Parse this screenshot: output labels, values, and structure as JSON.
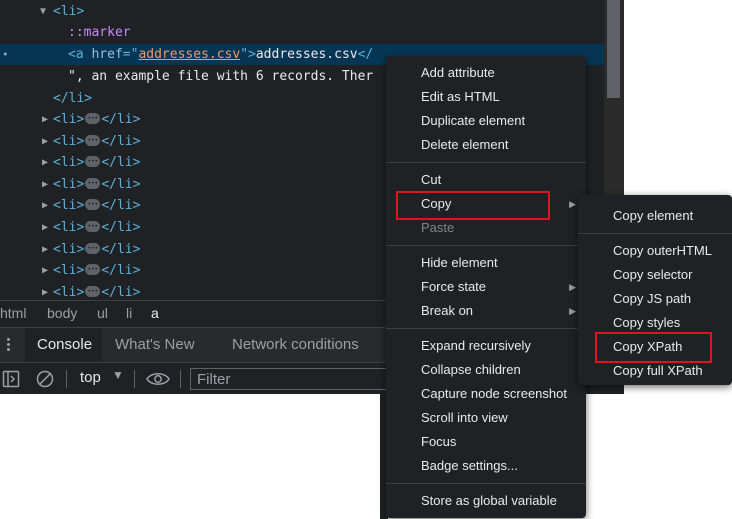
{
  "elements_tree": {
    "lines": [
      {
        "open": "<li>"
      },
      {
        "pseudo": "::marker"
      },
      {
        "a_open": "<a ",
        "href_attr": "href",
        "href_eq": "=\"",
        "href_val": "addresses.csv",
        "href_close": "\">",
        "text": "addresses.csv",
        "tail": "</"
      },
      {
        "text": "\", an example file with 6 records. Ther"
      },
      {
        "close": "</li>"
      },
      {
        "collapsed": "<li>",
        "end": "</li>"
      }
    ],
    "collapsed_count": 9
  },
  "breadcrumb": [
    "html",
    "body",
    "ul",
    "li",
    "a"
  ],
  "drawer": {
    "tabs": [
      "Console",
      "What's New",
      "Network conditions"
    ],
    "active_tab": "Console"
  },
  "console_toolbar": {
    "context": "top",
    "filter_placeholder": "Filter"
  },
  "context_menu": {
    "groups": [
      [
        "Add attribute",
        "Edit as HTML",
        "Duplicate element",
        "Delete element"
      ],
      [
        "Cut",
        "Copy",
        "Paste"
      ],
      [
        "Hide element",
        "Force state",
        "Break on"
      ],
      [
        "Expand recursively",
        "Collapse children",
        "Capture node screenshot",
        "Scroll into view",
        "Focus",
        "Badge settings..."
      ],
      [
        "Store as global variable"
      ]
    ],
    "has_submenu": [
      "Copy",
      "Force state",
      "Break on"
    ],
    "disabled": [
      "Paste"
    ],
    "highlighted": "Copy"
  },
  "copy_submenu": {
    "items": [
      "Copy element",
      "Copy outerHTML",
      "Copy selector",
      "Copy JS path",
      "Copy styles",
      "Copy XPath",
      "Copy full XPath"
    ],
    "highlighted": "Copy XPath"
  },
  "colors": {
    "highlight_border": "#e0131f",
    "tag": "#5db0d7",
    "attr_value": "#f29766",
    "pseudo": "#c58af9",
    "selected_row": "#073655"
  }
}
